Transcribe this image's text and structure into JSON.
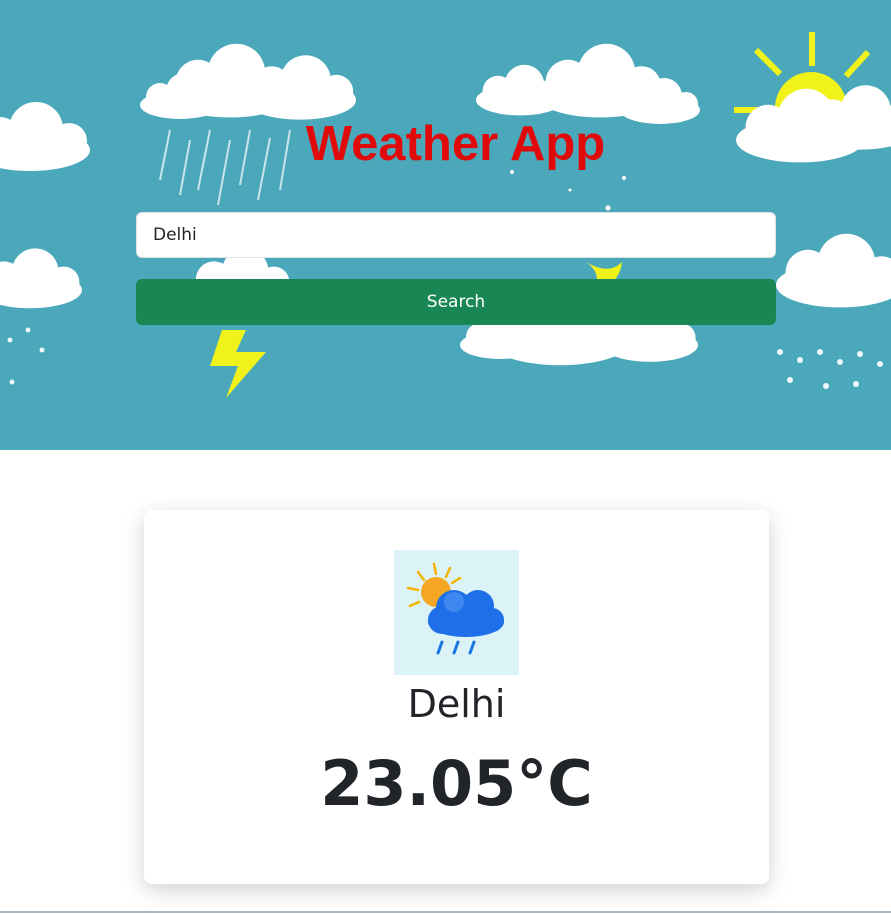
{
  "header": {
    "title": "Weather App",
    "search": {
      "value": "Delhi",
      "placeholder": "Enter city name"
    },
    "search_button_label": "Search"
  },
  "weather_card": {
    "icon": "sun-cloud-rain-icon",
    "city": "Delhi",
    "temperature": "23.05°C"
  },
  "colors": {
    "hero_background": "#4ba8bb",
    "title": "#e10a0a",
    "search_button": "#198754",
    "sun": "#f0f21a",
    "text": "#212529"
  }
}
